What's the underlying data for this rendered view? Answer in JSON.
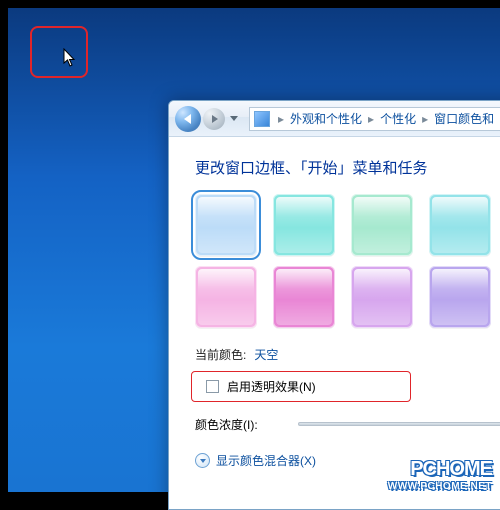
{
  "breadcrumb": {
    "seg1": "外观和个性化",
    "seg2": "个性化",
    "seg3": "窗口颜色和"
  },
  "page": {
    "title": "更改窗口边框、「开始」菜单和任务",
    "current_color_label": "当前颜色:",
    "current_color_value": "天空",
    "transparency_label": "启用透明效果(N)",
    "intensity_label": "颜色浓度(I):",
    "mixer_label": "显示颜色混合器(X)"
  },
  "swatches": [
    {
      "name": "sky",
      "color": "#bcdcf8",
      "selected": true
    },
    {
      "name": "teal",
      "color": "#86e6e0"
    },
    {
      "name": "mint",
      "color": "#a6e9cf"
    },
    {
      "name": "aqua",
      "color": "#93e3e9"
    },
    {
      "name": "pink",
      "color": "#f5b4e4"
    },
    {
      "name": "magenta",
      "color": "#e986d5"
    },
    {
      "name": "lavender",
      "color": "#d7a6ee"
    },
    {
      "name": "violet",
      "color": "#b9a6ee"
    }
  ],
  "watermark": {
    "brand": "PCHOME",
    "url": "WWW.PCHOME.NET"
  }
}
